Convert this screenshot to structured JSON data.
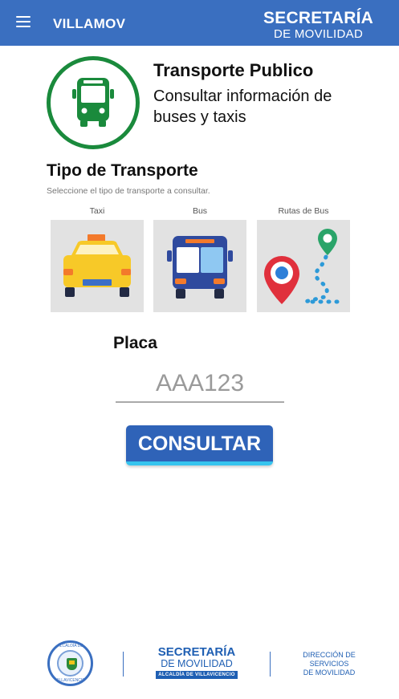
{
  "appbar": {
    "title": "VILLAMOV",
    "brand_line1": "SECRETARÍA",
    "brand_line2": "DE MOVILIDAD"
  },
  "header": {
    "title": "Transporte Publico",
    "subtitle": "Consultar información de buses y taxis"
  },
  "transport": {
    "title": "Tipo de Transporte",
    "hint": "Seleccione el tipo de transporte a consultar.",
    "options": [
      {
        "label": "Taxi",
        "icon": "taxi-icon"
      },
      {
        "label": "Bus",
        "icon": "bus-icon"
      },
      {
        "label": "Rutas de Bus",
        "icon": "route-map-icon"
      }
    ]
  },
  "plate": {
    "label": "Placa",
    "placeholder": "AAA123",
    "value": ""
  },
  "actions": {
    "consult_label": "CONSULTAR"
  },
  "footer": {
    "seal_top": "ALCALDÍA DE",
    "seal_bottom": "VILLAVICENCIO",
    "brand_line1": "SECRETARÍA",
    "brand_line2": "DE MOVILIDAD",
    "brand_line3": "ALCALDÍA DE VILLAVICENCIO",
    "dir_line1": "DIRECCIÓN DE",
    "dir_line2": "SERVICIOS",
    "dir_line3": "DE MOVILIDAD"
  },
  "colors": {
    "appbar": "#3a6fc0",
    "accent_green": "#1a8a3c",
    "button": "#2f63b8",
    "button_underline": "#36c4ee",
    "footer_blue": "#1f5fb3"
  }
}
